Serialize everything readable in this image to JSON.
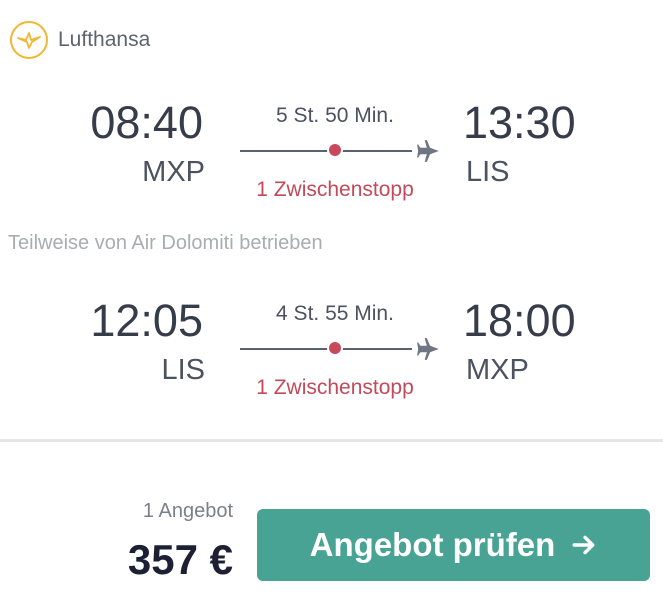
{
  "airline": {
    "name": "Lufthansa",
    "logo_color": "#f2b632"
  },
  "outbound": {
    "departure_time": "08:40",
    "departure_airport": "MXP",
    "duration": "5 St. 50 Min.",
    "stops": "1 Zwischenstopp",
    "arrival_time": "13:30",
    "arrival_airport": "LIS"
  },
  "operated_by": "Teilweise von Air Dolomiti betrieben",
  "return": {
    "departure_time": "12:05",
    "departure_airport": "LIS",
    "duration": "4 St. 55 Min.",
    "stops": "1 Zwischenstopp",
    "arrival_time": "18:00",
    "arrival_airport": "MXP"
  },
  "offer": {
    "count_label": "1 Angebot",
    "price": "357 €",
    "cta_label": "Angebot prüfen"
  },
  "colors": {
    "accent": "#48a394",
    "stop": "#c24a5a",
    "price": "#1d2035"
  },
  "icons": {
    "logo": "lufthansa-crane-icon",
    "plane": "airplane-icon",
    "arrow": "arrow-right-icon"
  }
}
